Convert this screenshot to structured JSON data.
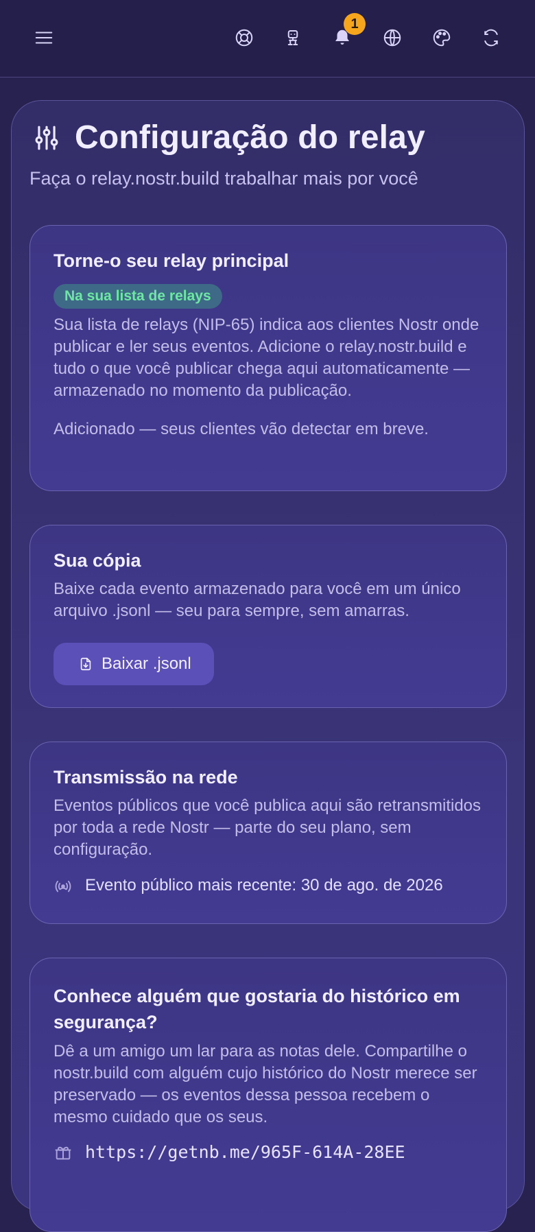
{
  "topbar": {
    "icons": [
      "menu-icon",
      "lifebuoy-icon",
      "robot-icon",
      "bell-icon",
      "globe-icon",
      "palette-icon",
      "refresh-icon"
    ],
    "notification_count": "1",
    "badge_color": "#f5a61c"
  },
  "page": {
    "title": "Configuração do relay",
    "subtitle": "Faça o relay.nostr.build trabalhar mais por você"
  },
  "cards": {
    "primary": {
      "title": "Torne-o seu relay principal",
      "status_chip": "Na sua lista de relays",
      "description": "Sua lista de relays (NIP-65) indica aos clientes Nostr onde publicar e ler seus eventos. Adicione o relay.nostr.build e tudo o que você publicar chega aqui automaticamente — armazenado no momento da publicação.",
      "status_note": "Adicionado — seus clientes vão detectar em breve."
    },
    "copy": {
      "title": "Sua cópia",
      "description": "Baixe cada evento armazenado para você em um único arquivo .jsonl — seu para sempre, sem amarras.",
      "button_label": "Baixar .jsonl"
    },
    "broadcast": {
      "title": "Transmissão na rede",
      "description": "Eventos públicos que você publica aqui são retransmitidos por toda a rede Nostr — parte do seu plano, sem configuração.",
      "latest_event": "Evento público mais recente: 30 de ago. de 2026"
    },
    "referral": {
      "title": "Conhece alguém que gostaria do histórico em segurança?",
      "description": "Dê a um amigo um lar para as notas dele. Compartilhe o nostr.build com alguém cujo histórico do Nostr merece ser preservado — os eventos dessa pessoa recebem o mesmo cuidado que os seus.",
      "link": "https://getnb.me/965F-614A-28EE"
    }
  },
  "colors": {
    "background": "#27224f",
    "card": "#433b92",
    "chip_text": "#6ee7a4",
    "button": "#5b4fb8"
  }
}
